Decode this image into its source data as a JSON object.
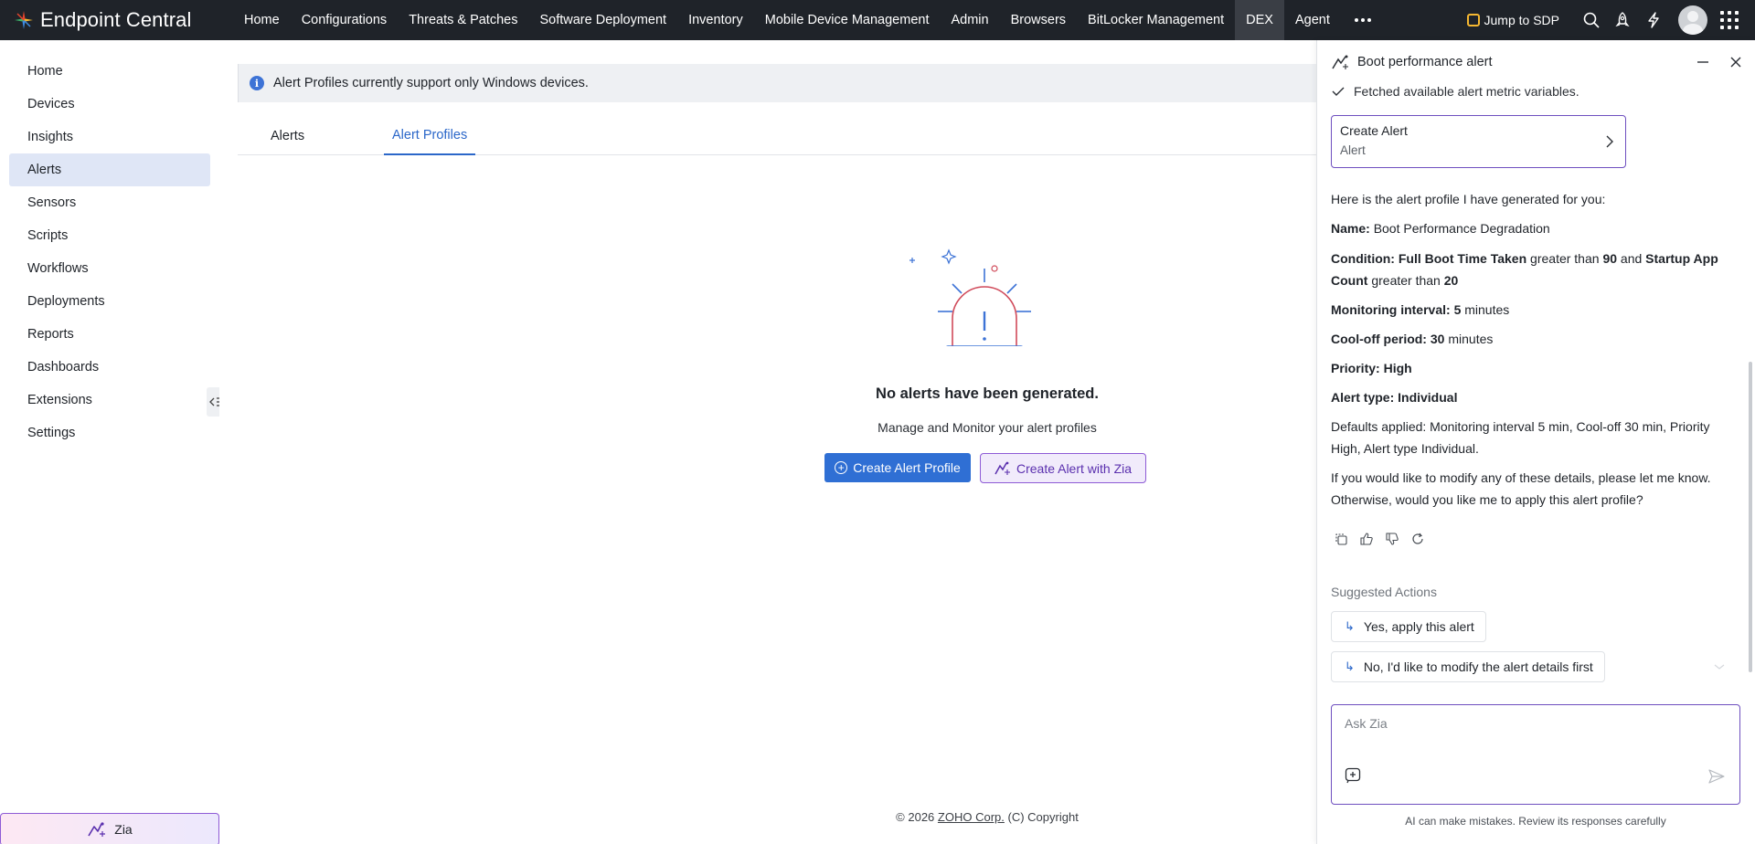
{
  "brand": {
    "name": "Endpoint Central"
  },
  "nav": {
    "items": [
      "Home",
      "Configurations",
      "Threats & Patches",
      "Software Deployment",
      "Inventory",
      "Mobile Device Management",
      "Admin",
      "Browsers",
      "BitLocker Management",
      "DEX",
      "Agent"
    ],
    "active": "DEX",
    "more_icon": "more-horizontal-icon"
  },
  "topright": {
    "jump_label": "Jump to SDP",
    "icons": [
      "search-icon",
      "rocket-icon",
      "lightning-icon",
      "avatar",
      "app-grid-icon"
    ]
  },
  "sidebar": {
    "items": [
      "Home",
      "Devices",
      "Insights",
      "Alerts",
      "Sensors",
      "Scripts",
      "Workflows",
      "Deployments",
      "Reports",
      "Dashboards",
      "Extensions",
      "Settings"
    ],
    "active": "Alerts",
    "zia_label": "Zia"
  },
  "main": {
    "info_text": "Alert Profiles currently support only Windows devices.",
    "tabs": [
      "Alerts",
      "Alert Profiles"
    ],
    "active_tab": "Alert Profiles",
    "empty_title": "No alerts have been generated.",
    "empty_subtitle": "Manage and Monitor your alert profiles",
    "create_profile_label": "Create Alert Profile",
    "create_zia_label": "Create Alert with Zia",
    "footer_prefix": "© 2026",
    "footer_link": "ZOHO Corp.",
    "footer_suffix": "(C) Copyright"
  },
  "panel": {
    "title": "Boot performance alert",
    "fetched_text": "Fetched available alert metric variables.",
    "card_title": "Create Alert",
    "card_subtitle": "Alert",
    "intro": "Here is the alert profile I have generated for you:",
    "name_label": "Name:",
    "name_value": "Boot Performance Degradation",
    "condition_label": "Condition:",
    "condition_metric1": "Full Boot Time Taken",
    "condition_op1": "greater than",
    "condition_val1": "90",
    "condition_and": "and",
    "condition_metric2": "Startup App Count",
    "condition_op2": "greater than",
    "condition_val2": "20",
    "monitoring_label": "Monitoring interval:",
    "monitoring_value": "5",
    "monitoring_unit": "minutes",
    "cooloff_label": "Cool-off period:",
    "cooloff_value": "30",
    "cooloff_unit": "minutes",
    "priority_label": "Priority:",
    "priority_value": "High",
    "alerttype_label": "Alert type:",
    "alerttype_value": "Individual",
    "defaults_text": "Defaults applied: Monitoring interval 5 min, Cool-off 30 min, Priority High, Alert type Individual.",
    "followup_text": "If you would like to modify any of these details, please let me know. Otherwise, would you like me to apply this alert profile?",
    "suggested_label": "Suggested Actions",
    "suggestions": [
      "Yes, apply this alert",
      "No, I'd like to modify the alert details first"
    ],
    "ask_placeholder": "Ask Zia",
    "disclaimer": "AI can make mistakes. Review its responses carefully"
  }
}
